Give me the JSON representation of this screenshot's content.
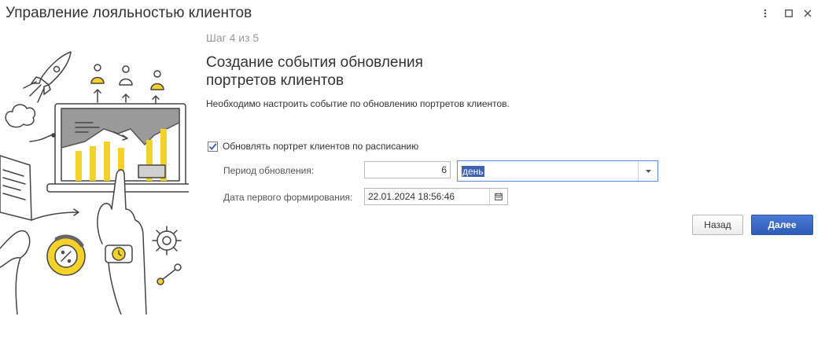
{
  "window": {
    "title": "Управление лояльностью клиентов",
    "controls": [
      "more-icon",
      "maximize-icon",
      "close-icon"
    ]
  },
  "wizard": {
    "step": "Шаг 4 из 5",
    "heading_line1": "Создание события обновления",
    "heading_line2": "портретов клиентов",
    "description": "Необходимо настроить событие по обновлению портретов клиентов."
  },
  "form": {
    "schedule_checkbox": {
      "label": "Обновлять портрет клиентов по расписанию",
      "checked": true
    },
    "period_label": "Период обновления:",
    "period_value": "6",
    "period_unit": "день",
    "first_date_label": "Дата первого формирования:",
    "first_date_value": "22.01.2024 18:56:46"
  },
  "buttons": {
    "back": "Назад",
    "next": "Далее"
  },
  "colors": {
    "accent_yellow": "#f4d22a",
    "primary_blue": "#3a66c4",
    "selection_blue": "#3e62b4"
  }
}
